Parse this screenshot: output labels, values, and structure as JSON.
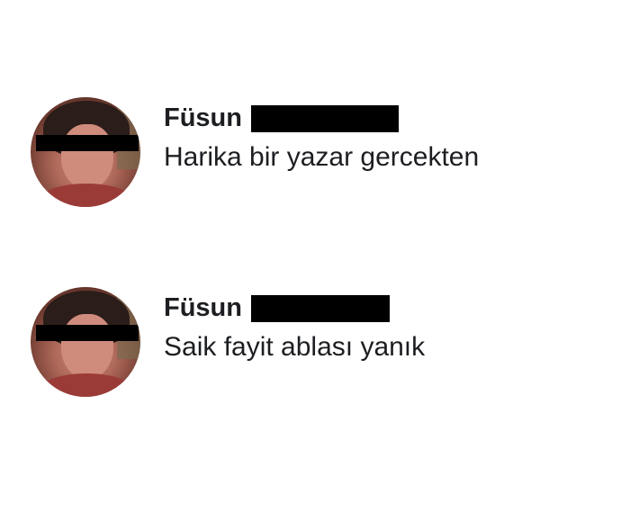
{
  "comments": [
    {
      "author": "Füsun",
      "text": "Harika bir yazar gercekten"
    },
    {
      "author": "Füsun",
      "text": "Saik fayit ablası yanık"
    }
  ]
}
